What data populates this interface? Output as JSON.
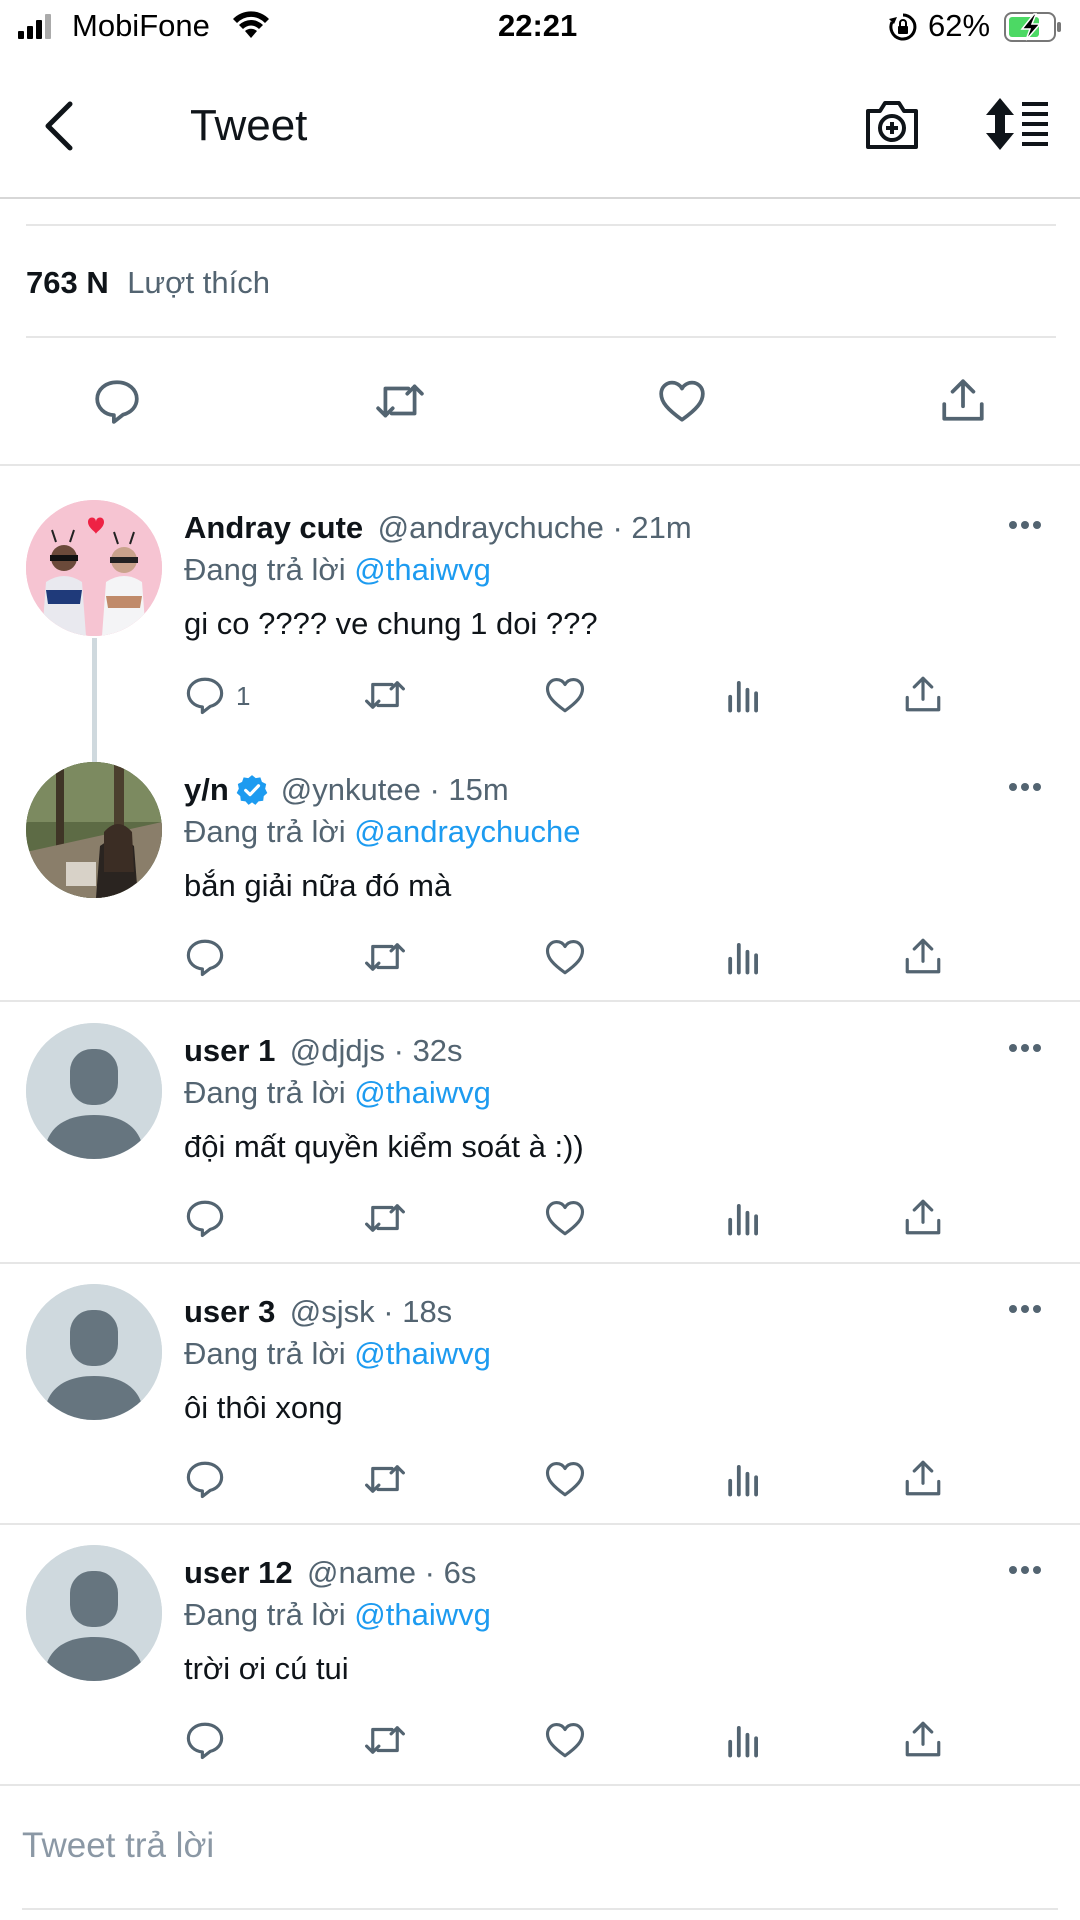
{
  "status_bar": {
    "carrier": "MobiFone",
    "time": "22:21",
    "battery": "62%",
    "icons": [
      "signal-icon",
      "wifi-icon",
      "rotation-lock-icon",
      "battery-charging-icon"
    ]
  },
  "nav": {
    "title": "Tweet",
    "icons": [
      "back-icon",
      "camera-add-icon",
      "sort-icon"
    ]
  },
  "likes": {
    "count": "763 N",
    "label": "Lượt thích"
  },
  "main_actions": [
    "reply-icon",
    "retweet-icon",
    "like-icon",
    "share-icon"
  ],
  "replies": [
    {
      "name": "Andray cute",
      "handle_time": "@andraychuche · 21m",
      "reply_prefix": "Đang trả lời",
      "reply_to": "@thaiwvg",
      "text": "gi co ???? ve chung 1 doi ???",
      "reply_count": "1",
      "avatar": "photo-avatar"
    },
    {
      "name": "y/n",
      "verified": true,
      "handle_time": "@ynkutee · 15m",
      "reply_prefix": "Đang trả lời",
      "reply_to": "@andraychuche",
      "text": "bắn giải nữa đó mà",
      "avatar": "photo-avatar"
    },
    {
      "name": "user 1",
      "handle_time": "@djdjs · 32s",
      "reply_prefix": "Đang trả lời",
      "reply_to": "@thaiwvg",
      "text": "đội mất quyền kiểm soát à :))",
      "avatar": "default-avatar"
    },
    {
      "name": "user 3",
      "handle_time": "@sjsk · 18s",
      "reply_prefix": "Đang trả lời",
      "reply_to": "@thaiwvg",
      "text": "ôi thôi xong",
      "avatar": "default-avatar"
    },
    {
      "name": "user 12",
      "handle_time": "@name · 6s",
      "reply_prefix": "Đang trả lời",
      "reply_to": "@thaiwvg",
      "text": "trời ơi cú tui",
      "avatar": "default-avatar"
    }
  ],
  "composer": {
    "placeholder": "Tweet trả lời"
  },
  "colors": {
    "accent": "#1d9bf0",
    "text": "#0f1419",
    "muted": "#536471",
    "icon": "#536471",
    "battery": "#4cd964"
  }
}
